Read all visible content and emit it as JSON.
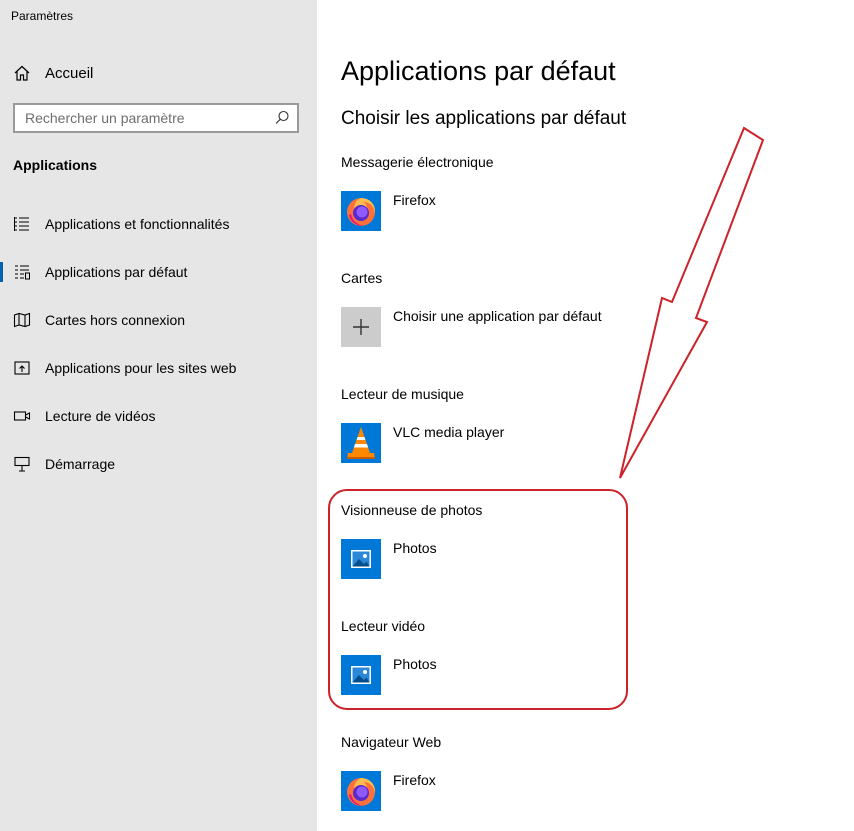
{
  "window": {
    "title": "Paramètres"
  },
  "sidebar": {
    "home_label": "Accueil",
    "search_placeholder": "Rechercher un paramètre",
    "section": "Applications",
    "items": [
      {
        "label": "Applications et fonctionnalités",
        "icon": "list-icon",
        "active": false
      },
      {
        "label": "Applications par défaut",
        "icon": "default-apps-icon",
        "active": true
      },
      {
        "label": "Cartes hors connexion",
        "icon": "map-icon",
        "active": false
      },
      {
        "label": "Applications pour les sites web",
        "icon": "open-in-app-icon",
        "active": false
      },
      {
        "label": "Lecture de vidéos",
        "icon": "video-icon",
        "active": false
      },
      {
        "label": "Démarrage",
        "icon": "startup-icon",
        "active": false
      }
    ]
  },
  "main": {
    "title": "Applications par défaut",
    "subtitle": "Choisir les applications par défaut",
    "categories": [
      {
        "label": "Messagerie électronique",
        "app": "Firefox",
        "icon": "firefox-icon"
      },
      {
        "label": "Cartes",
        "app": "Choisir une application par défaut",
        "icon": "plus-icon"
      },
      {
        "label": "Lecteur de musique",
        "app": "VLC media player",
        "icon": "vlc-icon"
      },
      {
        "label": "Visionneuse de photos",
        "app": "Photos",
        "icon": "photos-icon"
      },
      {
        "label": "Lecteur vidéo",
        "app": "Photos",
        "icon": "photos-icon"
      },
      {
        "label": "Navigateur Web",
        "app": "Firefox",
        "icon": "firefox-icon"
      }
    ]
  },
  "annotation": {
    "color": "#cc2229"
  },
  "colors": {
    "sidebar_bg": "#e6e6e6",
    "accent": "#0063b1",
    "tile_blue": "#0078d7"
  }
}
